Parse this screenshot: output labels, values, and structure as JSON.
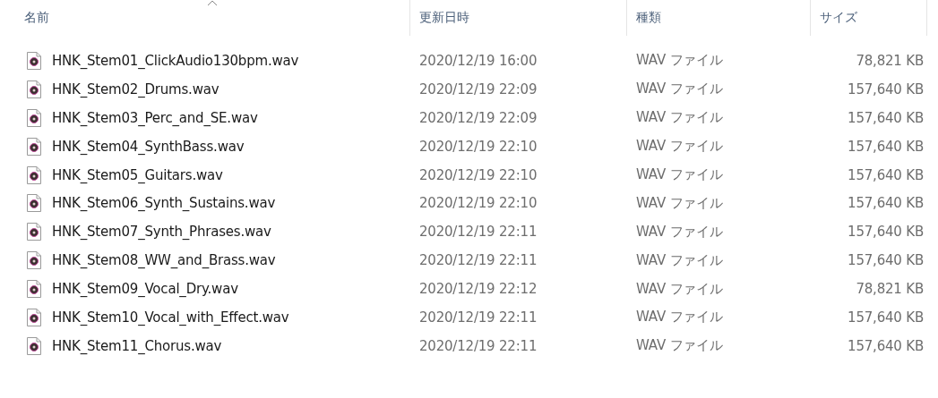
{
  "columns": [
    {
      "label": "名前",
      "sorted": true
    },
    {
      "label": "更新日時",
      "sorted": false
    },
    {
      "label": "種類",
      "sorted": false
    },
    {
      "label": "サイズ",
      "sorted": false
    }
  ],
  "rows": [
    {
      "name": "HNK_Stem01_ClickAudio130bpm.wav",
      "modified": "2020/12/19 16:00",
      "type": "WAV ファイル",
      "size": "78,821 KB"
    },
    {
      "name": "HNK_Stem02_Drums.wav",
      "modified": "2020/12/19 22:09",
      "type": "WAV ファイル",
      "size": "157,640 KB"
    },
    {
      "name": "HNK_Stem03_Perc_and_SE.wav",
      "modified": "2020/12/19 22:09",
      "type": "WAV ファイル",
      "size": "157,640 KB"
    },
    {
      "name": "HNK_Stem04_SynthBass.wav",
      "modified": "2020/12/19 22:10",
      "type": "WAV ファイル",
      "size": "157,640 KB"
    },
    {
      "name": "HNK_Stem05_Guitars.wav",
      "modified": "2020/12/19 22:10",
      "type": "WAV ファイル",
      "size": "157,640 KB"
    },
    {
      "name": "HNK_Stem06_Synth_Sustains.wav",
      "modified": "2020/12/19 22:10",
      "type": "WAV ファイル",
      "size": "157,640 KB"
    },
    {
      "name": "HNK_Stem07_Synth_Phrases.wav",
      "modified": "2020/12/19 22:11",
      "type": "WAV ファイル",
      "size": "157,640 KB"
    },
    {
      "name": "HNK_Stem08_WW_and_Brass.wav",
      "modified": "2020/12/19 22:11",
      "type": "WAV ファイル",
      "size": "157,640 KB"
    },
    {
      "name": "HNK_Stem09_Vocal_Dry.wav",
      "modified": "2020/12/19 22:12",
      "type": "WAV ファイル",
      "size": "78,821 KB"
    },
    {
      "name": "HNK_Stem10_Vocal_with_Effect.wav",
      "modified": "2020/12/19 22:11",
      "type": "WAV ファイル",
      "size": "157,640 KB"
    },
    {
      "name": "HNK_Stem11_Chorus.wav",
      "modified": "2020/12/19 22:11",
      "type": "WAV ファイル",
      "size": "157,640 KB"
    }
  ]
}
